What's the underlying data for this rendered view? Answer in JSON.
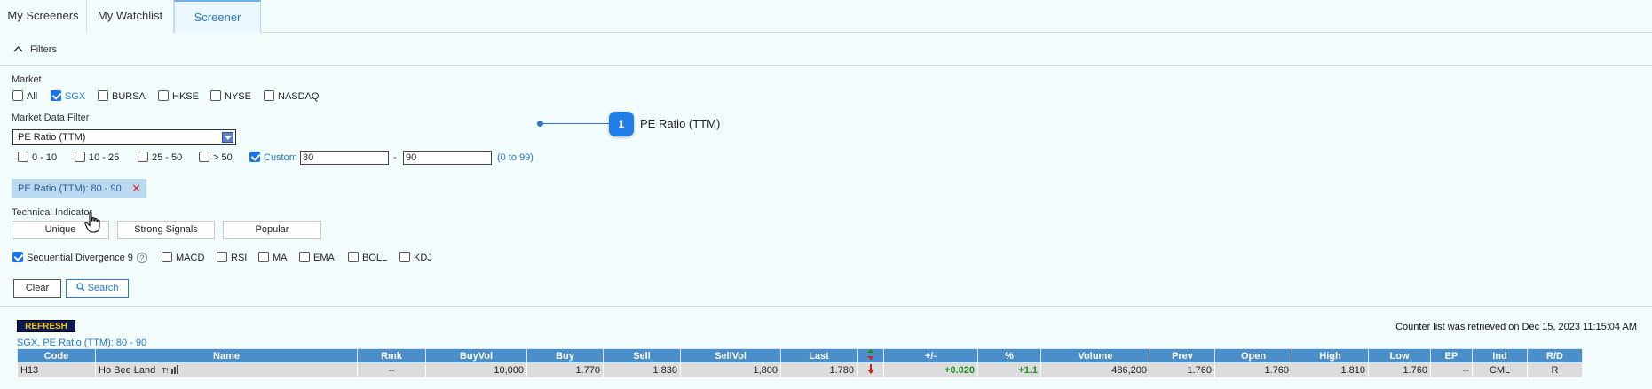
{
  "tabs": [
    {
      "label": "My Screeners"
    },
    {
      "label": "My Watchlist"
    },
    {
      "label": "Screener"
    }
  ],
  "filters_header": {
    "label": "Filters"
  },
  "market": {
    "label": "Market",
    "options": [
      {
        "label": "All",
        "checked": false
      },
      {
        "label": "SGX",
        "checked": true
      },
      {
        "label": "BURSA",
        "checked": false
      },
      {
        "label": "HKSE",
        "checked": false
      },
      {
        "label": "NYSE",
        "checked": false
      },
      {
        "label": "NASDAQ",
        "checked": false
      }
    ]
  },
  "market_data_filter": {
    "label": "Market Data Filter",
    "selected": "PE Ratio (TTM)",
    "ranges": [
      {
        "label": "0 - 10",
        "checked": false
      },
      {
        "label": "10 - 25",
        "checked": false
      },
      {
        "label": "25 - 50",
        "checked": false
      },
      {
        "label": "> 50",
        "checked": false
      }
    ],
    "custom": {
      "label": "Custom",
      "checked": true,
      "from": "80",
      "to": "90",
      "sep": "-",
      "hint": "(0 to 99)"
    },
    "chip": {
      "label": "PE Ratio (TTM): 80 - 90",
      "remove": "✕"
    }
  },
  "technical_indicator": {
    "label": "Technical Indicator",
    "buttons": [
      "Unique",
      "Strong Signals",
      "Popular"
    ],
    "options": [
      {
        "label": "Sequential Divergence 9",
        "checked": true,
        "help": "?"
      },
      {
        "label": "MACD",
        "checked": false
      },
      {
        "label": "RSI",
        "checked": false
      },
      {
        "label": "MA",
        "checked": false
      },
      {
        "label": "EMA",
        "checked": false
      },
      {
        "label": "BOLL",
        "checked": false
      },
      {
        "label": "KDJ",
        "checked": false
      }
    ]
  },
  "actions": {
    "clear": "Clear",
    "search": "Search"
  },
  "callout": {
    "number": "1",
    "text": "PE Ratio (TTM)"
  },
  "results": {
    "refresh": "REFRESH",
    "retrieved": "Counter list was retrieved on Dec 15, 2023 11:15:04 AM",
    "subtitle": "SGX, PE Ratio (TTM): 80 - 90",
    "columns": [
      "Code",
      "Name",
      "Rmk",
      "BuyVol",
      "Buy",
      "Sell",
      "SellVol",
      "Last",
      "",
      "+/-",
      "%",
      "Volume",
      "Prev",
      "Open",
      "High",
      "Low",
      "EP",
      "Ind",
      "R/D"
    ],
    "rows": [
      {
        "code": "H13",
        "name": "Ho Bee Land",
        "rmk": "--",
        "buyvol": "10,000",
        "buy": "1.770",
        "sell": "1.830",
        "sellvol": "1,800",
        "last": "1.780",
        "change": "+0.020",
        "pct": "+1.1",
        "volume": "486,200",
        "prev": "1.760",
        "open": "1.760",
        "high": "1.810",
        "low": "1.760",
        "ep": "--",
        "ind": "CML",
        "rd": "R"
      }
    ]
  },
  "colors": {
    "accent": "#2a78c6",
    "header_blue": "#4a8fc9",
    "highlight": "#fff4a6",
    "up_green": "#1e8c1e"
  }
}
